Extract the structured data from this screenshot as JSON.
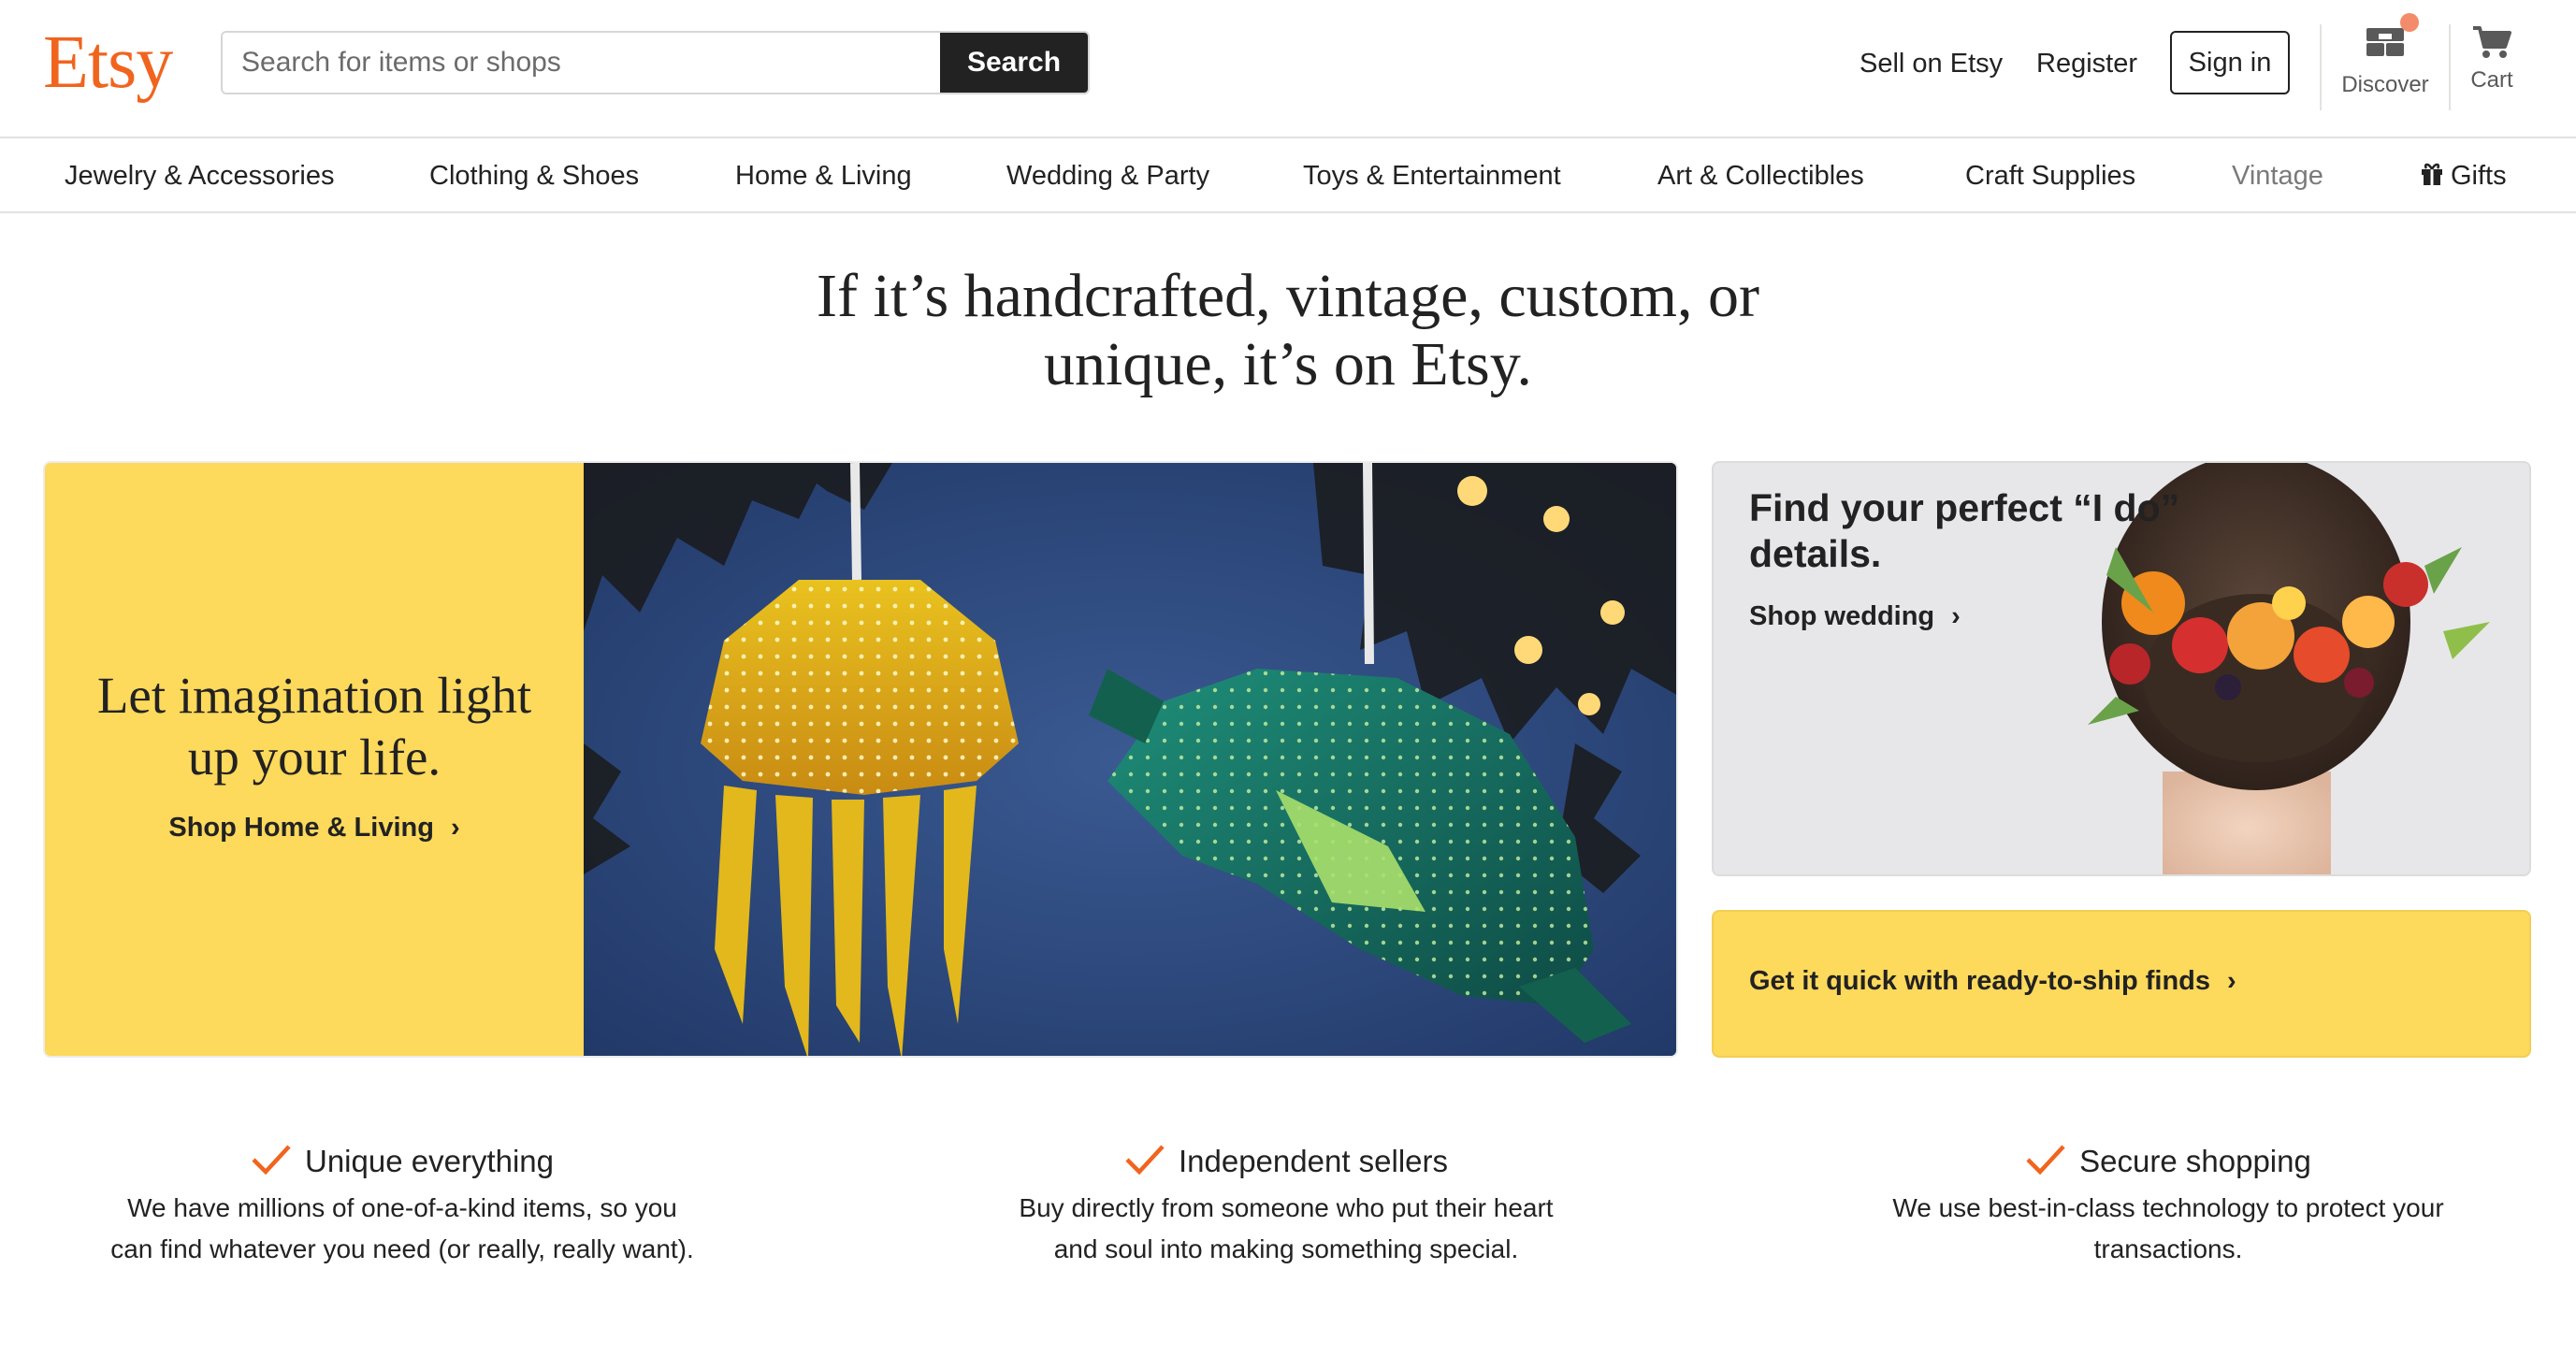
{
  "header": {
    "logo": "Etsy",
    "search": {
      "placeholder": "Search for items or shops",
      "button_label": "Search"
    },
    "links": {
      "sell": "Sell on Etsy",
      "register": "Register",
      "sign_in": "Sign in"
    },
    "discover_label": "Discover",
    "cart_label": "Cart"
  },
  "categories": [
    "Jewelry & Accessories",
    "Clothing & Shoes",
    "Home & Living",
    "Wedding & Party",
    "Toys & Entertainment",
    "Art & Collectibles",
    "Craft Supplies",
    "Vintage",
    "Gifts"
  ],
  "headline": {
    "line1": "If it’s handcrafted, vintage, custom, or",
    "line2": "unique, it’s on Etsy."
  },
  "hero": {
    "title_line1": "Let imagination light",
    "title_line2": "up your life.",
    "link": "Shop Home & Living"
  },
  "wedding_card": {
    "title_line1": "Find your perfect “I do”",
    "title_line2": "details.",
    "link": "Shop wedding"
  },
  "ship_card": {
    "link": "Get it quick with ready-to-ship finds"
  },
  "value_props": [
    {
      "title": "Unique everything",
      "line1": "We have millions of one-of-a-kind items, so you",
      "line2": "can find whatever you need (or really, really want)."
    },
    {
      "title": "Independent sellers",
      "line1": "Buy directly from someone who put their heart",
      "line2": "and soul into making something special."
    },
    {
      "title": "Secure shopping",
      "line1": "We use best-in-class technology to protect your",
      "line2": "transactions."
    }
  ],
  "colors": {
    "brand": "#f1641e",
    "promo_yellow": "#fdd95c",
    "text": "#222222"
  }
}
